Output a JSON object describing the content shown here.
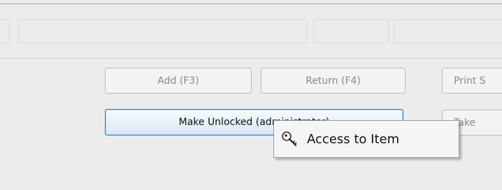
{
  "buttons": {
    "add": "Add (F3)",
    "return": "Return (F4)",
    "print": "Print S",
    "make_unlocked": "Make Unlocked (administrator)",
    "take": "Take"
  },
  "context_menu": {
    "item_label": "Access to Item",
    "item_icon": "key-icon"
  }
}
